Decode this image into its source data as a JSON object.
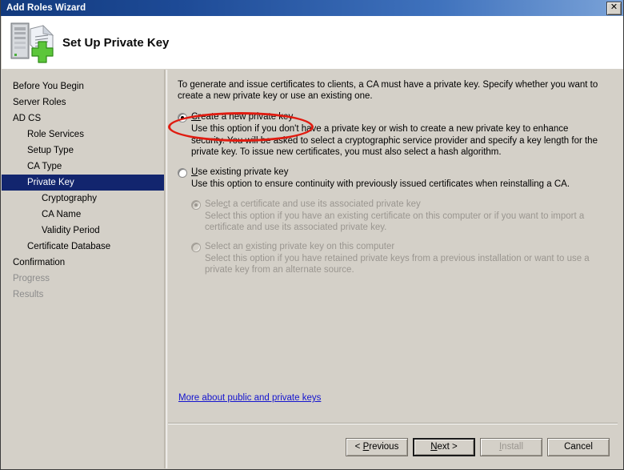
{
  "window": {
    "title": "Add Roles Wizard",
    "close_label": "✕"
  },
  "header": {
    "title": "Set Up Private Key",
    "icon": "server-certificate-add-icon"
  },
  "sidebar": {
    "items": [
      {
        "label": "Before You Begin",
        "level": 0,
        "state": "normal"
      },
      {
        "label": "Server Roles",
        "level": 0,
        "state": "normal"
      },
      {
        "label": "AD CS",
        "level": 0,
        "state": "normal"
      },
      {
        "label": "Role Services",
        "level": 1,
        "state": "normal"
      },
      {
        "label": "Setup Type",
        "level": 1,
        "state": "normal"
      },
      {
        "label": "CA Type",
        "level": 1,
        "state": "normal"
      },
      {
        "label": "Private Key",
        "level": 1,
        "state": "selected"
      },
      {
        "label": "Cryptography",
        "level": 2,
        "state": "normal"
      },
      {
        "label": "CA Name",
        "level": 2,
        "state": "normal"
      },
      {
        "label": "Validity Period",
        "level": 2,
        "state": "normal"
      },
      {
        "label": "Certificate Database",
        "level": 1,
        "state": "normal"
      },
      {
        "label": "Confirmation",
        "level": 0,
        "state": "normal"
      },
      {
        "label": "Progress",
        "level": 0,
        "state": "disabled"
      },
      {
        "label": "Results",
        "level": 0,
        "state": "disabled"
      }
    ]
  },
  "content": {
    "intro": "To generate and issue certificates to clients, a CA must have a private key. Specify whether you want to create a new private key or use an existing one.",
    "option_create": {
      "label_accel": "Cr",
      "label_rest": "eate a new private key",
      "description": "Use this option if you don't have a private key or wish to create a new private key to enhance security. You will be asked to select a cryptographic service provider and specify a key length for the private key. To issue new certificates, you must also select a hash algorithm.",
      "checked": true,
      "enabled": true
    },
    "option_existing": {
      "label_accel": "U",
      "label_rest": "se existing private key",
      "description": "Use this option to ensure continuity with previously issued certificates when reinstalling a CA.",
      "checked": false,
      "enabled": true
    },
    "sub_option_certificate": {
      "label_pre": "Sele",
      "label_accel": "c",
      "label_rest": "t a certificate and use its associated private key",
      "description": "Select this option if you have an existing certificate on this computer or if you want to import a certificate and use its associated private key.",
      "checked": true,
      "enabled": false
    },
    "sub_option_private_key": {
      "label_pre": "Select an ",
      "label_accel": "e",
      "label_rest": "xisting private key on this computer",
      "description": "Select this option if you have retained private keys from a previous installation or want to use a private key from an alternate source.",
      "checked": false,
      "enabled": false
    },
    "more_link": "More about public and private keys",
    "annotation": {
      "shape": "ellipse",
      "color": "#e01b10",
      "target": "Create a new private key"
    }
  },
  "footer": {
    "buttons": [
      {
        "pre": "< ",
        "accel": "P",
        "post": "revious",
        "state": "normal"
      },
      {
        "pre": "",
        "accel": "N",
        "post": "ext >",
        "state": "focused"
      },
      {
        "pre": "",
        "accel": "I",
        "post": "nstall",
        "state": "disabled"
      },
      {
        "pre": "",
        "accel": "",
        "post": "Cancel",
        "state": "normal"
      }
    ]
  },
  "colors": {
    "titlebar_start": "#123a7d",
    "titlebar_end": "#7ba3d8",
    "dialog_face": "#d4d0c8",
    "selection": "#12256e",
    "link": "#1414cf",
    "annotation": "#e01b10",
    "disabled_text": "#9a9690"
  }
}
